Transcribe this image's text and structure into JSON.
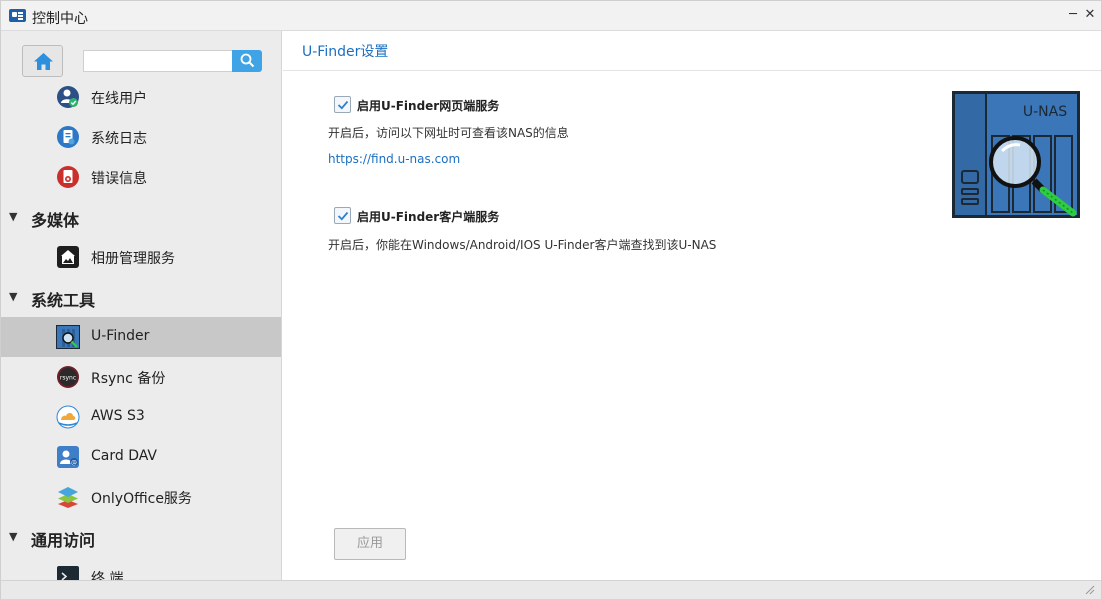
{
  "window": {
    "title": "控制中心"
  },
  "sidebar": {
    "search": {
      "value": "",
      "placeholder": ""
    },
    "items_top": [
      {
        "label": "在线用户",
        "icon": "online-users-icon"
      },
      {
        "label": "系统日志",
        "icon": "system-log-icon"
      },
      {
        "label": "错误信息",
        "icon": "error-info-icon"
      }
    ],
    "groups": [
      {
        "label": "多媒体",
        "items": [
          {
            "label": "相册管理服务",
            "icon": "album-icon"
          }
        ]
      },
      {
        "label": "系统工具",
        "items": [
          {
            "label": "U-Finder",
            "icon": "u-finder-icon",
            "active": true
          },
          {
            "label": "Rsync 备份",
            "icon": "rsync-icon"
          },
          {
            "label": "AWS S3",
            "icon": "aws-s3-icon"
          },
          {
            "label": "Card DAV",
            "icon": "card-dav-icon"
          },
          {
            "label": "OnlyOffice服务",
            "icon": "onlyoffice-icon"
          }
        ]
      },
      {
        "label": "通用访问",
        "items": [
          {
            "label": "终 端",
            "icon": "terminal-icon"
          }
        ]
      }
    ]
  },
  "main": {
    "title": "U-Finder设置",
    "option1": {
      "label": "启用U-Finder网页端服务",
      "checked": true,
      "desc": "开启后，访问以下网址时可查看该NAS的信息",
      "link": "https://find.u-nas.com"
    },
    "option2": {
      "label": "启用U-Finder客户端服务",
      "checked": true,
      "desc": "开启后，你能在Windows/Android/IOS U-Finder客户端查找到该U-NAS"
    },
    "logo_text": "U-NAS",
    "apply_label": "应用"
  },
  "colors": {
    "accent": "#1b6fc2",
    "search_button": "#3fa3e6",
    "active_row": "#c8c8c8",
    "sidebar_bg": "#ececec"
  }
}
